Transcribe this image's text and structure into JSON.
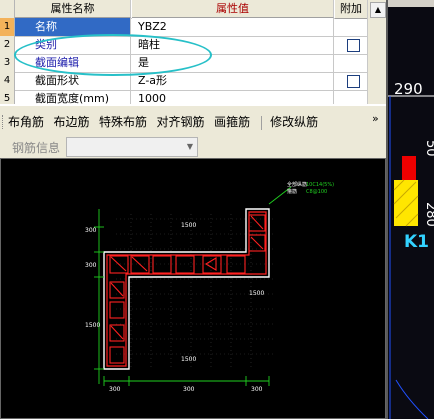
{
  "property_grid": {
    "header": {
      "name": "属性名称",
      "value": "属性值",
      "add": "附加"
    },
    "rows": [
      {
        "index": "1",
        "name": "名称",
        "value": "YBZ2",
        "has_checkbox": false,
        "selected": true
      },
      {
        "index": "2",
        "name": "类别",
        "value": "暗柱",
        "has_checkbox": true,
        "selected": false
      },
      {
        "index": "3",
        "name": "截面编辑",
        "value": "是",
        "has_checkbox": false,
        "selected": false
      },
      {
        "index": "4",
        "name": "截面形状",
        "value": "Z-a形",
        "has_checkbox": true,
        "selected": false
      },
      {
        "index": "5",
        "name": "截面宽度(mm)",
        "value": "1000",
        "has_checkbox": false,
        "selected": false
      }
    ]
  },
  "toolbar": {
    "buttons": [
      "布角筋",
      "布边筋",
      "特殊布筋",
      "对齐钢筋",
      "画箍筋",
      "修改纵筋"
    ],
    "more": "»",
    "rebar_info_label": "钢筋信息",
    "rebar_info_value": ""
  },
  "drawing": {
    "dim_labels": {
      "top_right_width": "1500",
      "mid_right": "1500",
      "bottom": "1500",
      "left_top": "300",
      "left_mid": "300",
      "left_lower": "1500",
      "bottom_a": "300",
      "bottom_b": "300",
      "bottom_c": "300"
    },
    "annotation_line1": "全部纵筋",
    "annotation_line2": "箍筋",
    "annotation_value1": "10C14(5%)",
    "annotation_value2": "C8@100"
  },
  "right_panel": {
    "label_290": "290",
    "label_k1": "K1",
    "vertical_text_a": "50",
    "vertical_text_b": "280"
  },
  "colors": {
    "selection": "#316ac5",
    "oval": "#27c0c8",
    "rebar": "#ff2020",
    "dimension": "#20d020",
    "outline": "#ffffff"
  }
}
